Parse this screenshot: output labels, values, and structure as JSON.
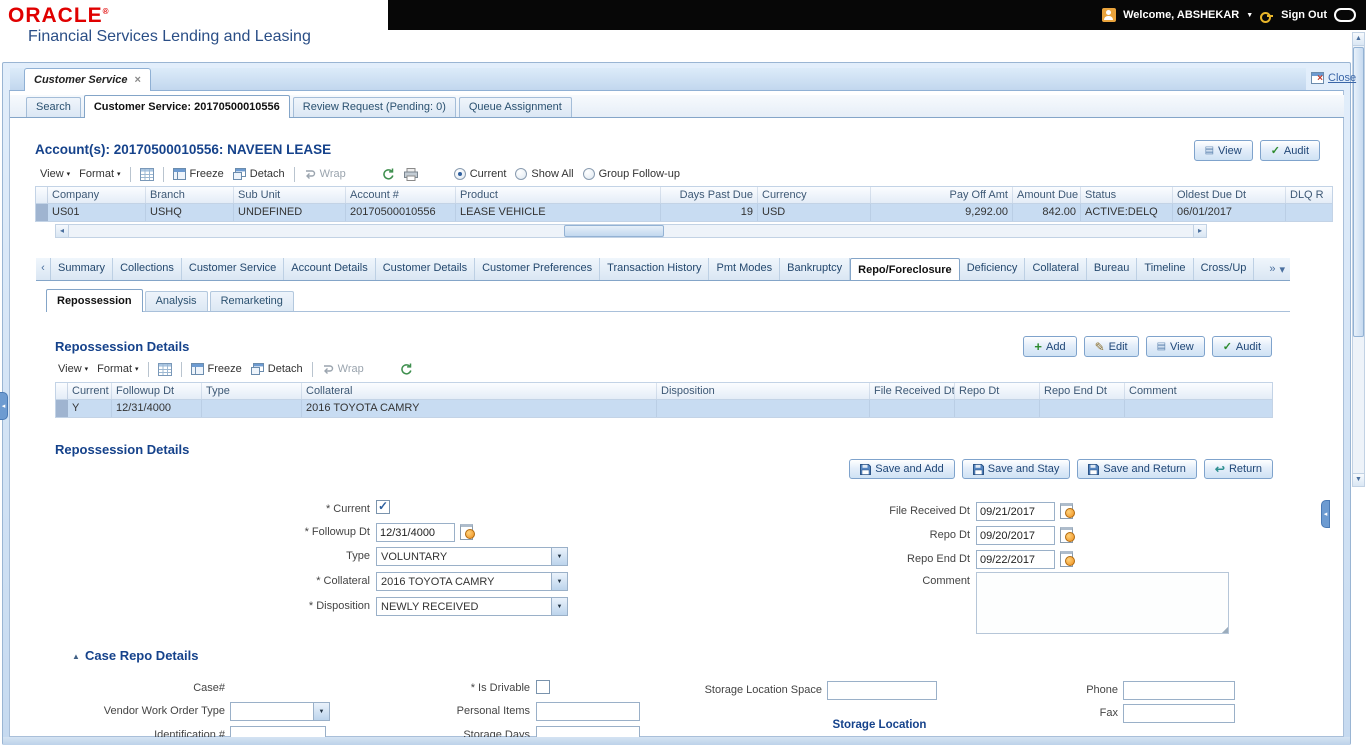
{
  "header": {
    "logo": "ORACLE",
    "logo_mark": "®",
    "product": "Financial Services Lending and Leasing",
    "welcome": "Welcome, ABSHEKAR",
    "sign_out": "Sign Out"
  },
  "window": {
    "tab_label": "Customer Service",
    "close_label": "Close"
  },
  "main_tabs": [
    "Search",
    "Customer Service: 20170500010556",
    "Review Request (Pending: 0)",
    "Queue Assignment"
  ],
  "toolbar": {
    "view": "View",
    "format": "Format",
    "freeze": "Freeze",
    "detach": "Detach",
    "wrap": "Wrap"
  },
  "account": {
    "title": "Account(s): 20170500010556: NAVEEN LEASE",
    "view_btn": "View",
    "audit_btn": "Audit",
    "radios": [
      "Current",
      "Show All",
      "Group Follow-up"
    ],
    "columns": [
      "Company",
      "Branch",
      "Sub Unit",
      "Account #",
      "Product",
      "Days Past Due",
      "Currency",
      "Pay Off Amt",
      "Amount Due",
      "Status",
      "Oldest Due Dt",
      "DLQ R"
    ],
    "row": [
      "US01",
      "USHQ",
      "UNDEFINED",
      "20170500010556",
      "LEASE VEHICLE",
      "19",
      "USD",
      "9,292.00",
      "842.00",
      "ACTIVE:DELQ",
      "06/01/2017",
      ""
    ]
  },
  "detail_tabs": [
    "Summary",
    "Collections",
    "Customer Service",
    "Account Details",
    "Customer Details",
    "Customer Preferences",
    "Transaction History",
    "Pmt Modes",
    "Bankruptcy",
    "Repo/Foreclosure",
    "Deficiency",
    "Collateral",
    "Bureau",
    "Timeline",
    "Cross/Up"
  ],
  "repo_tabs": [
    "Repossession",
    "Analysis",
    "Remarketing"
  ],
  "repo_grid": {
    "title": "Repossession Details",
    "add_btn": "Add",
    "edit_btn": "Edit",
    "view_btn": "View",
    "audit_btn": "Audit",
    "columns": [
      "Current",
      "Followup Dt",
      "Type",
      "Collateral",
      "Disposition",
      "File Received Dt",
      "Repo Dt",
      "Repo End Dt",
      "Comment"
    ],
    "row": [
      "Y",
      "12/31/4000",
      "",
      "2016 TOYOTA CAMRY",
      "",
      "",
      "",
      "",
      ""
    ]
  },
  "repo_form": {
    "title": "Repossession Details",
    "save_add_btn": "Save and Add",
    "save_stay_btn": "Save and Stay",
    "save_return_btn": "Save and Return",
    "return_btn": "Return",
    "current_label": "* Current",
    "followup_label": "* Followup Dt",
    "followup_value": "12/31/4000",
    "type_label": "Type",
    "type_value": "VOLUNTARY",
    "collateral_label": "* Collateral",
    "collateral_value": "2016 TOYOTA CAMRY",
    "disposition_label": "* Disposition",
    "disposition_value": "NEWLY RECEIVED",
    "file_received_label": "File Received Dt",
    "file_received_value": "09/21/2017",
    "repo_dt_label": "Repo Dt",
    "repo_dt_value": "09/20/2017",
    "repo_end_label": "Repo End Dt",
    "repo_end_value": "09/22/2017",
    "comment_label": "Comment"
  },
  "case_repo": {
    "title": "Case Repo Details",
    "case_label": "Case#",
    "vendor_label": "Vendor Work Order Type",
    "identification_label": "Identification #",
    "is_drivable_label": "* Is Drivable",
    "personal_items_label": "Personal Items",
    "storage_days_label": "Storage Days",
    "storage_space_label": "Storage Location Space",
    "storage_location_title": "Storage Location",
    "phone_label": "Phone",
    "fax_label": "Fax"
  }
}
